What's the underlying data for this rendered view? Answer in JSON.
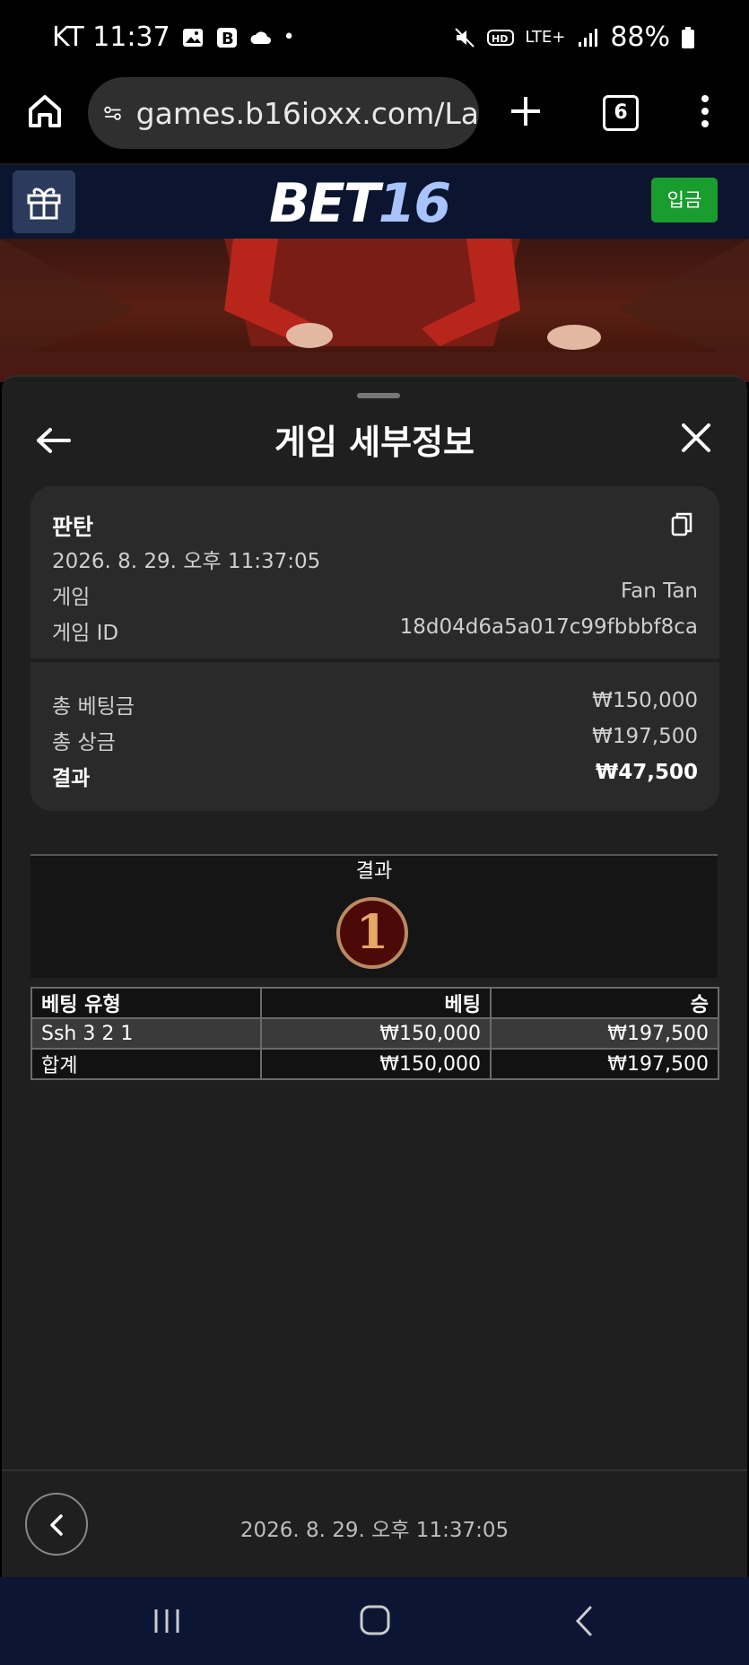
{
  "status": {
    "carrier_time": "KT 11:37",
    "battery": "88%",
    "network": "LTE+"
  },
  "browser": {
    "url": "games.b16ioxx.com/La",
    "tab_count": "6"
  },
  "site": {
    "logo_part1": "BET",
    "logo_part2": "16",
    "deposit_label": "입금"
  },
  "panel": {
    "title": "게임 세부정보",
    "game_name": "판탄",
    "datetime": "2026. 8. 29. 오후 11:37:05",
    "game_label": "게임",
    "game_value": "Fan Tan",
    "game_id_label": "게임 ID",
    "game_id_value": "18d04d6a5a017c99fbbbf8ca",
    "total_bet_label": "총 베팅금",
    "total_bet_value": "₩150,000",
    "total_prize_label": "총 상금",
    "total_prize_value": "₩197,500",
    "result_label": "결과",
    "result_value": "₩47,500"
  },
  "result_table": {
    "header": "결과",
    "ball_number": "1",
    "columns": [
      "베팅 유형",
      "베팅",
      "승"
    ],
    "rows": [
      [
        "Ssh 3 2 1",
        "₩150,000",
        "₩197,500"
      ],
      [
        "합계",
        "₩150,000",
        "₩197,500"
      ]
    ]
  },
  "footer": {
    "datetime": "2026. 8. 29. 오후 11:37:05"
  },
  "colors": {
    "deposit_green": "#1a9d2f",
    "header_navy": "#0b1530",
    "ball_red": "#4b0908"
  }
}
